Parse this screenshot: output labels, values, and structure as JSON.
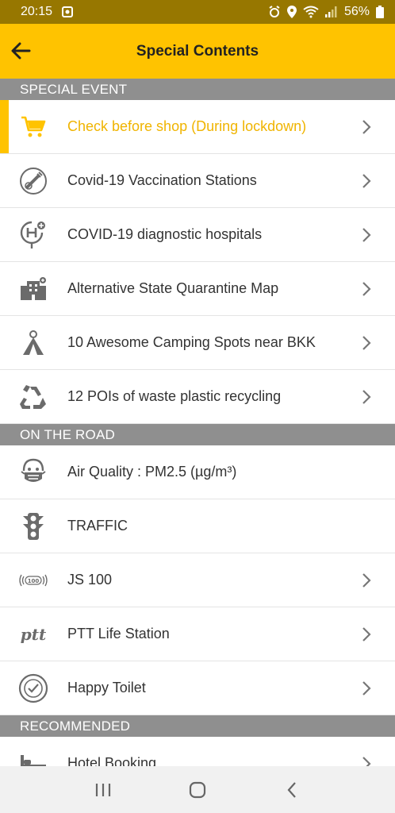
{
  "status": {
    "time": "20:15",
    "battery": "56%"
  },
  "header": {
    "title": "Special Contents"
  },
  "sections": [
    {
      "title": "SPECIAL EVENT",
      "items": [
        {
          "label": "Check before shop (During lockdown)",
          "icon": "shopping-cart-icon",
          "active": true,
          "chevron": true
        },
        {
          "label": "Covid-19 Vaccination Stations",
          "icon": "vaccine-icon",
          "chevron": true
        },
        {
          "label": "COVID-19 diagnostic hospitals",
          "icon": "hospital-pin-icon",
          "chevron": true
        },
        {
          "label": "Alternative State Quarantine Map",
          "icon": "building-icon",
          "chevron": true
        },
        {
          "label": "10 Awesome Camping Spots near BKK",
          "icon": "tent-icon",
          "chevron": true
        },
        {
          "label": "12 POIs of waste plastic recycling",
          "icon": "recycle-icon",
          "chevron": true
        }
      ]
    },
    {
      "title": "ON THE ROAD",
      "items": [
        {
          "label": "Air Quality : PM2.5 (µg/m³)",
          "icon": "face-mask-icon",
          "chevron": false
        },
        {
          "label": "TRAFFIC",
          "icon": "traffic-light-icon",
          "chevron": false
        },
        {
          "label": "JS 100",
          "icon": "js100-radio-icon",
          "chevron": true
        },
        {
          "label": "PTT Life Station",
          "icon": "ptt-logo-icon",
          "chevron": true
        },
        {
          "label": "Happy Toilet",
          "icon": "happy-toilet-badge-icon",
          "chevron": true
        }
      ]
    },
    {
      "title": "RECOMMENDED",
      "items": [
        {
          "label": "Hotel Booking",
          "icon": "bed-icon",
          "chevron": true
        }
      ]
    }
  ],
  "colors": {
    "accent": "#ffc300",
    "status_bar": "#977700",
    "section_header": "#8f8f8f",
    "active_text": "#f0b400",
    "icon_gray": "#6b6b6b"
  },
  "icon_text": {
    "js100": "(( จส 100 ))",
    "ptt": "ptt"
  }
}
